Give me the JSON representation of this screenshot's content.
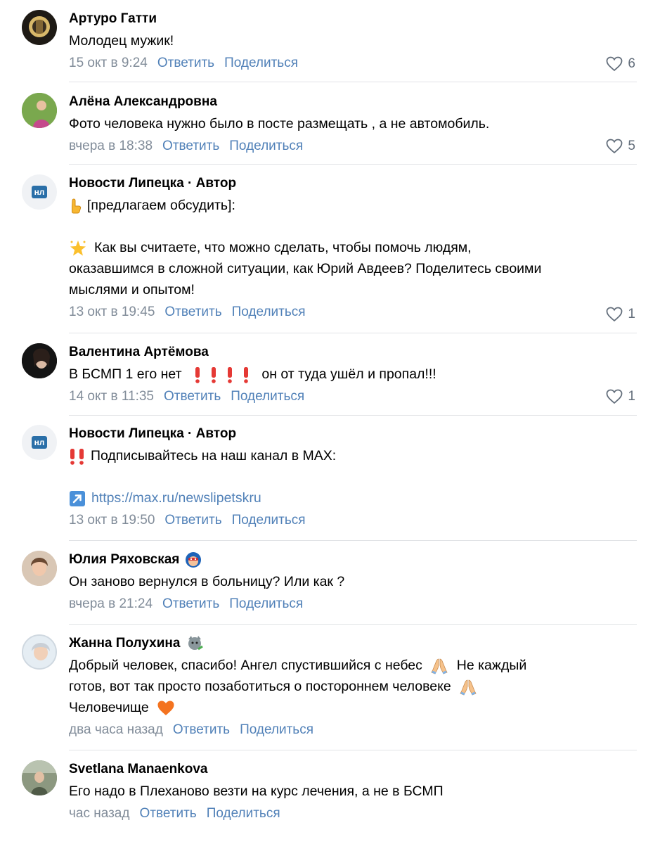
{
  "comments": [
    {
      "author": "Артуро Гатти",
      "lines": [
        "Молодец мужик!"
      ],
      "date": "15 окт в 9:24",
      "reply": "Ответить",
      "share": "Поделиться",
      "likes": "6"
    },
    {
      "author": "Алёна Александровна",
      "lines": [
        "Фото человека нужно было в посте размещать , а не автомобиль."
      ],
      "date": "вчера в 18:38",
      "reply": "Ответить",
      "share": "Поделиться",
      "likes": "5"
    },
    {
      "author": "Новости Липецка · Автор",
      "avatar_text": "нл",
      "lines": [
        "[предлагаем обсудить]:",
        "",
        "Как вы считаете, что можно сделать, чтобы помочь людям,",
        "оказавшимся в сложной ситуации, как Юрий Авдеев? Поделитесь своими",
        "мыслями и опытом!"
      ],
      "date": "13 окт в 19:45",
      "reply": "Ответить",
      "share": "Поделиться",
      "likes": "1"
    },
    {
      "author": "Валентина Артёмова",
      "lines": [
        "В БСМП 1 его нет",
        "он от туда ушёл и пропал!!!"
      ],
      "date": "14 окт в 11:35",
      "reply": "Ответить",
      "share": "Поделиться",
      "likes": "1"
    },
    {
      "author": "Новости Липецка · Автор",
      "avatar_text": "нл",
      "lines": [
        "Подписывайтесь на наш канал в MAX:",
        "",
        "https://max.ru/newslipetskru"
      ],
      "date": "13 окт в 19:50",
      "reply": "Ответить",
      "share": "Поделиться"
    },
    {
      "author": "Юлия Ряховская",
      "lines": [
        "Он заново вернулся в больницу? Или как ?"
      ],
      "date": "вчера в 21:24",
      "reply": "Ответить",
      "share": "Поделиться"
    },
    {
      "author": "Жанна Полухина",
      "lines": [
        "Добрый человек, спасибо! Ангел спустившийся с небес",
        "Не каждый",
        "готов, вот так просто позаботиться о постороннем человеке",
        "Человечище"
      ],
      "date": "два часа назад",
      "reply": "Ответить",
      "share": "Поделиться"
    },
    {
      "author": "Svetlana Manaenkova",
      "lines": [
        "Его надо в Плеханово везти на курс лечения, а не в БСМП"
      ],
      "date": "час назад",
      "reply": "Ответить",
      "share": "Поделиться"
    }
  ],
  "icons": {
    "like": "heart-outline-icon",
    "point": "pointing-hand-emoji",
    "star": "glowing-star-emoji",
    "exclamation": "red-exclamation-emoji",
    "arrow": "up-right-arrow-emoji",
    "pray": "praying-hands-emoji",
    "heart": "orange-heart-emoji"
  },
  "colors": {
    "link": "#5181b8",
    "meta": "#818c99",
    "divider": "#e1e3e6",
    "brand": "#2a6fa8"
  }
}
